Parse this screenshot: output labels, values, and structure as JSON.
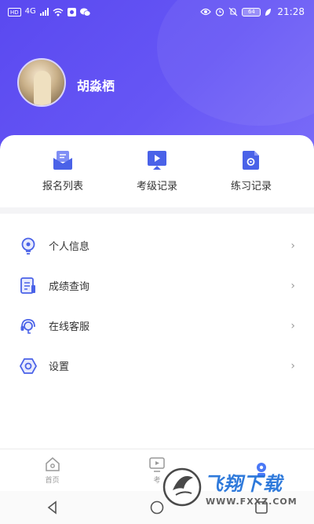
{
  "status_bar": {
    "left_badge": "HD",
    "net_label": "4G",
    "time": "21:28",
    "battery": "64"
  },
  "profile": {
    "username": "胡淼栖"
  },
  "quick_actions": [
    {
      "label": "报名列表",
      "icon": "envelope-icon"
    },
    {
      "label": "考级记录",
      "icon": "play-screen-icon"
    },
    {
      "label": "练习记录",
      "icon": "document-icon"
    }
  ],
  "menu": [
    {
      "label": "个人信息",
      "icon": "lightbulb-icon"
    },
    {
      "label": "成绩查询",
      "icon": "report-icon"
    },
    {
      "label": "在线客服",
      "icon": "headset-icon"
    },
    {
      "label": "设置",
      "icon": "hexagon-settings-icon"
    }
  ],
  "chevron": "›",
  "tabbar": [
    {
      "label": "首页",
      "icon": "home-icon"
    },
    {
      "label": "考",
      "icon": "exam-icon"
    },
    {
      "label": "",
      "icon": "profile-icon"
    }
  ],
  "watermark": {
    "title": "飞翔下载",
    "url": "WWW.FXXZ.COM"
  },
  "colors": {
    "header_gradient_start": "#5a49f0",
    "header_gradient_end": "#7a6cf8",
    "icon_blue": "#4a62e8",
    "active_tab": "#4a78f6"
  }
}
